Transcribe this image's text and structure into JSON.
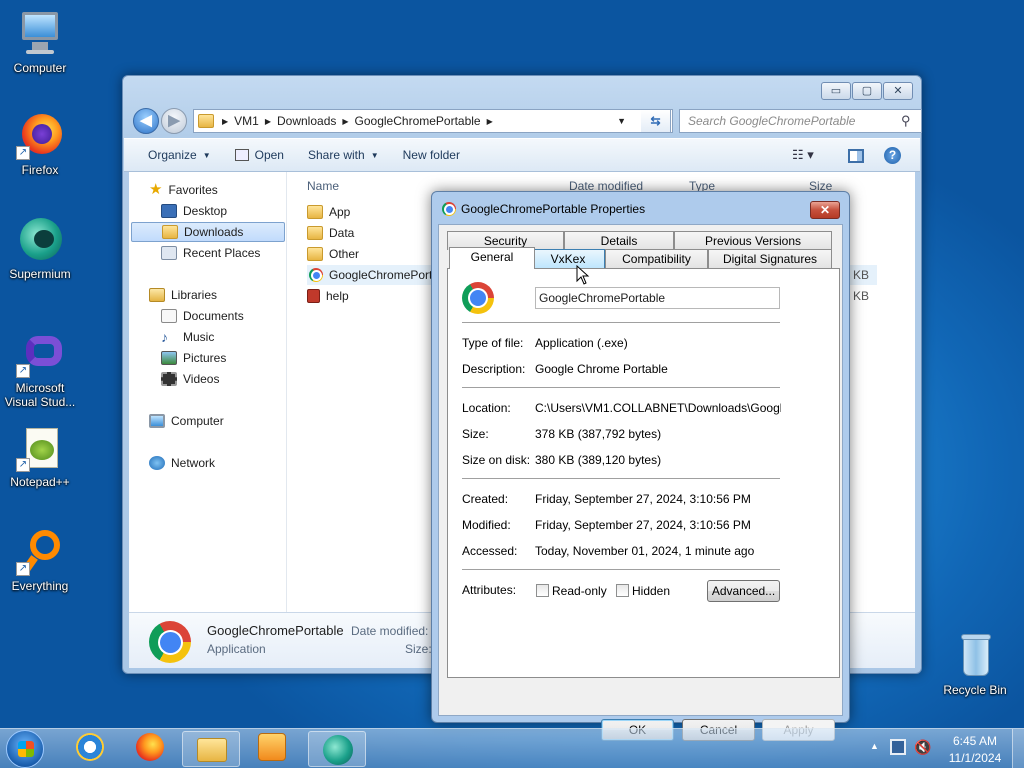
{
  "desktop": {
    "icons": [
      {
        "label": "Computer"
      },
      {
        "label": "Firefox"
      },
      {
        "label": "Supermium"
      },
      {
        "label": "Microsoft Visual Stud..."
      },
      {
        "label": "Notepad++"
      },
      {
        "label": "Everything"
      },
      {
        "label": "Recycle Bin"
      }
    ]
  },
  "explorer": {
    "caption_buttons": {
      "minimize": "▭",
      "maximize": "▢",
      "close": "✕"
    },
    "breadcrumb": [
      "VM1",
      "Downloads",
      "GoogleChromePortable"
    ],
    "search_placeholder": "Search GoogleChromePortable",
    "toolbar": {
      "organize": "Organize",
      "open": "Open",
      "share_with": "Share with",
      "new_folder": "New folder"
    },
    "nav": {
      "favorites": "Favorites",
      "desktop": "Desktop",
      "downloads": "Downloads",
      "recent": "Recent Places",
      "libraries": "Libraries",
      "documents": "Documents",
      "music": "Music",
      "pictures": "Pictures",
      "videos": "Videos",
      "computer": "Computer",
      "network": "Network"
    },
    "columns": {
      "name": "Name",
      "date_modified": "Date modified",
      "type": "Type",
      "size": "Size"
    },
    "files": [
      {
        "name": "App"
      },
      {
        "name": "Data"
      },
      {
        "name": "Other"
      },
      {
        "name": "GoogleChromePort",
        "size": "9 KB"
      },
      {
        "name": "help",
        "size": "0 KB"
      }
    ],
    "details": {
      "name": "GoogleChromePortable",
      "type": "Application",
      "date_label": "Date modified:",
      "size_label": "Size:"
    }
  },
  "dialog": {
    "title": "GoogleChromePortable Properties",
    "close": "✕",
    "tabs_row1": [
      "Security",
      "Details",
      "Previous Versions"
    ],
    "tabs_row2": [
      "General",
      "VxKex",
      "Compatibility",
      "Digital Signatures"
    ],
    "name_value": "GoogleChromePortable",
    "fields": {
      "type_label": "Type of file:",
      "type_value": "Application (.exe)",
      "desc_label": "Description:",
      "desc_value": "Google Chrome Portable",
      "location_label": "Location:",
      "location_value": "C:\\Users\\VM1.COLLABNET\\Downloads\\GoogleChr",
      "size_label": "Size:",
      "size_value": "378 KB (387,792 bytes)",
      "disk_label": "Size on disk:",
      "disk_value": "380 KB (389,120 bytes)",
      "created_label": "Created:",
      "created_value": "Friday, September 27, 2024, 3:10:56 PM",
      "modified_label": "Modified:",
      "modified_value": "Friday, September 27, 2024, 3:10:56 PM",
      "accessed_label": "Accessed:",
      "accessed_value": "Today, November 01, 2024, 1 minute ago",
      "attributes_label": "Attributes:",
      "readonly": "Read-only",
      "hidden": "Hidden",
      "advanced": "Advanced..."
    },
    "buttons": {
      "ok": "OK",
      "cancel": "Cancel",
      "apply": "Apply"
    }
  },
  "taskbar": {
    "time": "6:45 AM",
    "date": "11/1/2024"
  }
}
